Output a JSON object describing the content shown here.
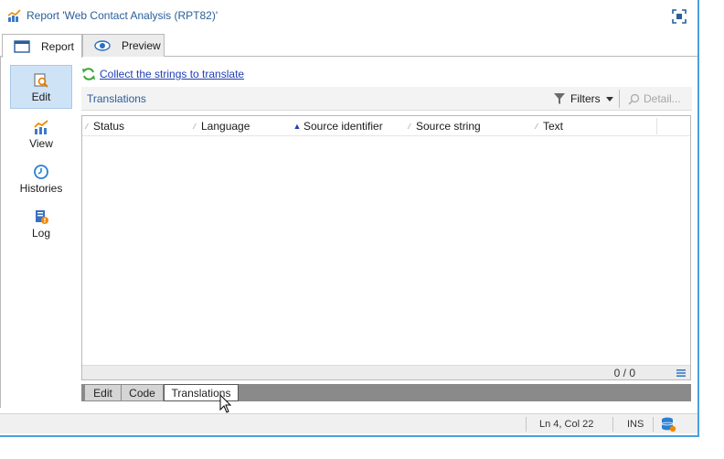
{
  "window": {
    "title": "Report 'Web Contact Analysis (RPT82)'",
    "accent_color": "#4aa0dd",
    "title_color": "#2a5d99"
  },
  "tabs": [
    {
      "label": "Report",
      "icon": "report-window-icon",
      "selected": true
    },
    {
      "label": "Preview",
      "icon": "eye-icon",
      "selected": false
    }
  ],
  "leftnav": {
    "items": [
      {
        "label": "Edit",
        "icon": "edit-magnifier-icon",
        "selected": true
      },
      {
        "label": "View",
        "icon": "chart-view-icon",
        "selected": false
      },
      {
        "label": "Histories",
        "icon": "clock-history-icon",
        "selected": false
      },
      {
        "label": "Log",
        "icon": "log-warning-icon",
        "selected": false
      }
    ]
  },
  "collect": {
    "link_text": "Collect the strings to translate",
    "icon": "refresh-icon"
  },
  "toolbar": {
    "title": "Translations",
    "filters_label": "Filters",
    "detail_label": "Detail..."
  },
  "grid": {
    "columns": [
      {
        "label": "Status",
        "sort": "none"
      },
      {
        "label": "Language",
        "sort": "none"
      },
      {
        "label": "Source identifier",
        "sort": "ascending"
      },
      {
        "label": "Source string",
        "sort": "none"
      },
      {
        "label": "Text",
        "sort": "none"
      }
    ],
    "rows": [],
    "count": "0 / 0"
  },
  "bottom_tabs": [
    {
      "label": "Edit",
      "active": false
    },
    {
      "label": "Code",
      "active": false
    },
    {
      "label": "Translations",
      "active": true
    }
  ],
  "statusbar": {
    "position": "Ln 4, Col 22",
    "mode": "INS"
  }
}
